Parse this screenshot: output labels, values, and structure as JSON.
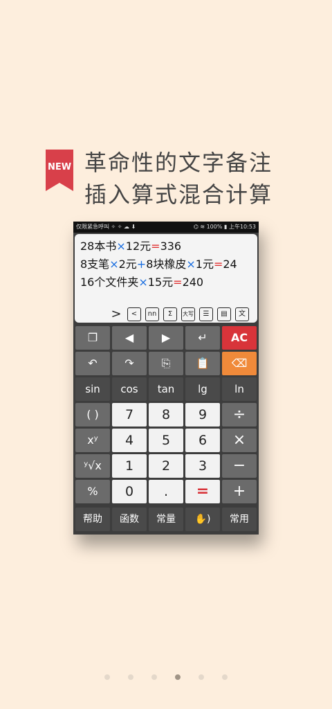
{
  "badge": {
    "label": "NEW"
  },
  "headline": {
    "line1": "革命性的文字备注",
    "line2": "插入算式混合计算"
  },
  "statusbar": {
    "left": "仅限紧急呼叫 ✧ ✧ ☁ ⬇",
    "right": "⌬ ≋ 100% ▮ 上午10:53"
  },
  "display": {
    "lines": [
      [
        {
          "t": "28本书",
          "c": ""
        },
        {
          "t": "×",
          "c": "op-blue"
        },
        {
          "t": "12元",
          "c": ""
        },
        {
          "t": "=",
          "c": "op-red"
        },
        {
          "t": "336",
          "c": ""
        }
      ],
      [
        {
          "t": "8支笔",
          "c": ""
        },
        {
          "t": "×",
          "c": "op-blue"
        },
        {
          "t": "2元",
          "c": ""
        },
        {
          "t": "+",
          "c": "op-blue"
        },
        {
          "t": "8块橡皮",
          "c": ""
        },
        {
          "t": "×",
          "c": "op-blue"
        },
        {
          "t": "1元",
          "c": ""
        },
        {
          "t": "=",
          "c": "op-red"
        },
        {
          "t": "24",
          "c": ""
        }
      ],
      [
        {
          "t": "16个文件夹",
          "c": ""
        },
        {
          "t": "×",
          "c": "op-blue"
        },
        {
          "t": "15元",
          "c": ""
        },
        {
          "t": "=",
          "c": "op-red"
        },
        {
          "t": "240",
          "c": ""
        }
      ]
    ]
  },
  "toolbar": {
    "expand": ">",
    "share": "<",
    "units": "nn",
    "sum": "Σ",
    "uppercase": "大写",
    "search": "☰",
    "save": "▤",
    "text": "文"
  },
  "keys": {
    "window": "❐",
    "left": "◀",
    "right": "▶",
    "enter": "↵",
    "ac": "AC",
    "undo": "↶",
    "redo": "↷",
    "copy": "⎘",
    "paste": "📋",
    "delete": "⌫",
    "sin": "sin",
    "cos": "cos",
    "tan": "tan",
    "lg": "lg",
    "ln": "ln",
    "paren": "( )",
    "seven": "7",
    "eight": "8",
    "nine": "9",
    "divide": "÷",
    "power": "xʸ",
    "four": "4",
    "five": "5",
    "six": "6",
    "multiply": "×",
    "root": "ʸ√x",
    "one": "1",
    "two": "2",
    "three": "3",
    "minus": "−",
    "percent": "%",
    "zero": "0",
    "dot": ".",
    "equals": "=",
    "plus": "+",
    "help": "帮助",
    "functions": "函数",
    "constants": "常量",
    "voice": "✋)",
    "common": "常用"
  },
  "pager": {
    "count": 6,
    "active": 3
  }
}
